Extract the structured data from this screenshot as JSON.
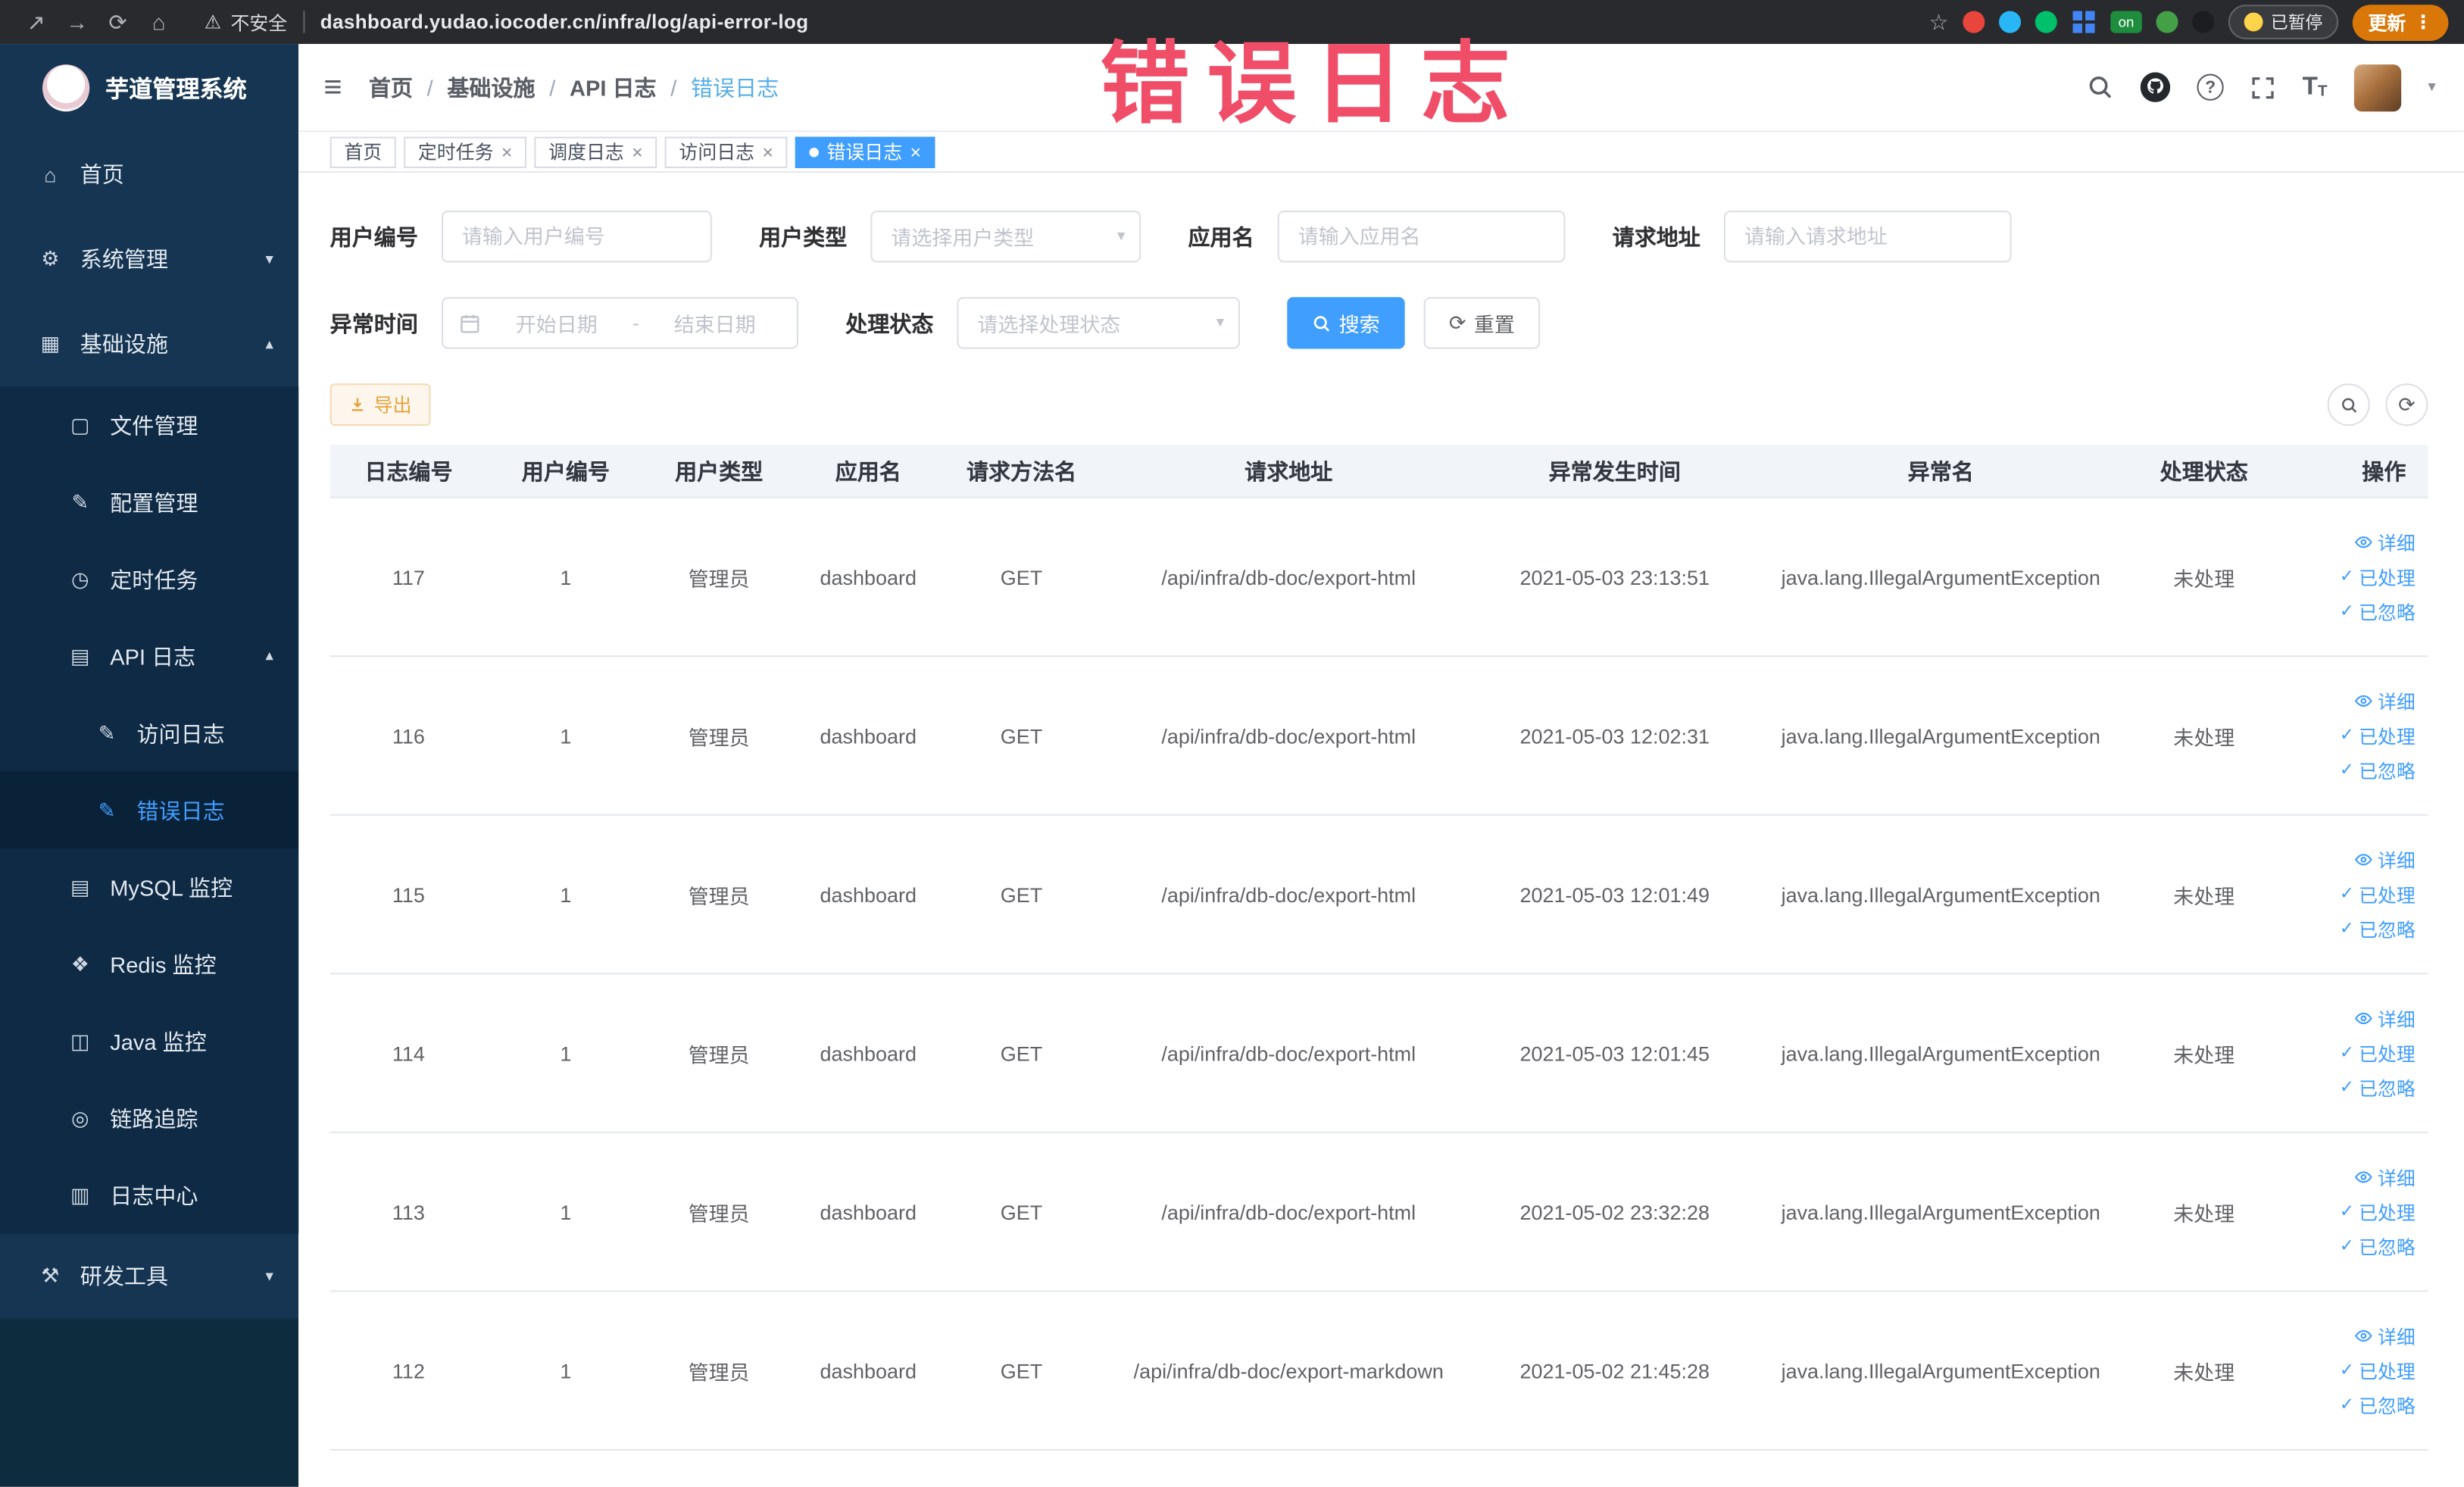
{
  "annotation": {
    "text": "错误日志"
  },
  "icons": {
    "share": "↗",
    "forward": "→",
    "reload": "⟳",
    "home": "⌂",
    "warning": "⚠",
    "star": "☆",
    "kebab": "⋮",
    "hamburger": "≡",
    "question": "?",
    "font": "T",
    "close": "×",
    "check": "✓",
    "caret_down": "▾",
    "caret_up": "▴",
    "refresh": "⟳",
    "menu_home": "⌂",
    "menu_gear": "⚙",
    "menu_infra": "▦",
    "menu_file": "▢",
    "menu_config": "✎",
    "menu_task": "◷",
    "menu_apilog": "▤",
    "menu_doc": "✎",
    "menu_mysql": "▤",
    "menu_redis": "❖",
    "menu_java": "◫",
    "menu_trace": "◎",
    "menu_logcenter": "▥",
    "menu_tools": "⚒"
  },
  "browser": {
    "security_label": "不安全",
    "url": "dashboard.yudao.iocoder.cn/infra/log/api-error-log",
    "extension_badge": "on",
    "paused_badge": "已暂停",
    "update_button": "更新"
  },
  "sidebar": {
    "logo_title": "芋道管理系统",
    "items": [
      {
        "label": "首页"
      },
      {
        "label": "系统管理"
      },
      {
        "label": "基础设施"
      },
      {
        "label": "文件管理"
      },
      {
        "label": "配置管理"
      },
      {
        "label": "定时任务"
      },
      {
        "label": "API 日志"
      },
      {
        "label": "访问日志"
      },
      {
        "label": "错误日志"
      },
      {
        "label": "MySQL 监控"
      },
      {
        "label": "Redis 监控"
      },
      {
        "label": "Java 监控"
      },
      {
        "label": "链路追踪"
      },
      {
        "label": "日志中心"
      },
      {
        "label": "研发工具"
      }
    ]
  },
  "navbar": {
    "breadcrumb": {
      "separator": "/",
      "items": [
        "首页",
        "基础设施",
        "API 日志",
        "错误日志"
      ]
    }
  },
  "tabs": [
    {
      "label": "首页"
    },
    {
      "label": "定时任务"
    },
    {
      "label": "调度日志"
    },
    {
      "label": "访问日志"
    },
    {
      "label": "错误日志"
    }
  ],
  "filters": {
    "user_id": {
      "label": "用户编号",
      "placeholder": "请输入用户编号"
    },
    "user_type": {
      "label": "用户类型",
      "placeholder": "请选择用户类型"
    },
    "app_name": {
      "label": "应用名",
      "placeholder": "请输入应用名"
    },
    "request_url": {
      "label": "请求地址",
      "placeholder": "请输入请求地址"
    },
    "exception_time": {
      "label": "异常时间",
      "start_placeholder": "开始日期",
      "separator": "-",
      "end_placeholder": "结束日期"
    },
    "process_status": {
      "label": "处理状态",
      "placeholder": "请选择处理状态"
    },
    "search_button": "搜索",
    "reset_button": "重置"
  },
  "toolbar": {
    "export_button": "导出"
  },
  "table": {
    "columns": [
      "日志编号",
      "用户编号",
      "用户类型",
      "应用名",
      "请求方法名",
      "请求地址",
      "异常发生时间",
      "异常名",
      "处理状态",
      "操作"
    ],
    "actions": {
      "detail": "详细",
      "processed": "已处理",
      "ignored": "已忽略"
    },
    "rows": [
      {
        "log_id": "117",
        "user_id": "1",
        "user_type": "管理员",
        "app_name": "dashboard",
        "method": "GET",
        "url": "/api/infra/db-doc/export-html",
        "time": "2021-05-03 23:13:51",
        "exception": "java.lang.IllegalArgumentException",
        "status": "未处理"
      },
      {
        "log_id": "116",
        "user_id": "1",
        "user_type": "管理员",
        "app_name": "dashboard",
        "method": "GET",
        "url": "/api/infra/db-doc/export-html",
        "time": "2021-05-03 12:02:31",
        "exception": "java.lang.IllegalArgumentException",
        "status": "未处理"
      },
      {
        "log_id": "115",
        "user_id": "1",
        "user_type": "管理员",
        "app_name": "dashboard",
        "method": "GET",
        "url": "/api/infra/db-doc/export-html",
        "time": "2021-05-03 12:01:49",
        "exception": "java.lang.IllegalArgumentException",
        "status": "未处理"
      },
      {
        "log_id": "114",
        "user_id": "1",
        "user_type": "管理员",
        "app_name": "dashboard",
        "method": "GET",
        "url": "/api/infra/db-doc/export-html",
        "time": "2021-05-03 12:01:45",
        "exception": "java.lang.IllegalArgumentException",
        "status": "未处理"
      },
      {
        "log_id": "113",
        "user_id": "1",
        "user_type": "管理员",
        "app_name": "dashboard",
        "method": "GET",
        "url": "/api/infra/db-doc/export-html",
        "time": "2021-05-02 23:32:28",
        "exception": "java.lang.IllegalArgumentException",
        "status": "未处理"
      },
      {
        "log_id": "112",
        "user_id": "1",
        "user_type": "管理员",
        "app_name": "dashboard",
        "method": "GET",
        "url": "/api/infra/db-doc/export-markdown",
        "time": "2021-05-02 21:45:28",
        "exception": "java.lang.IllegalArgumentException",
        "status": "未处理"
      }
    ]
  }
}
